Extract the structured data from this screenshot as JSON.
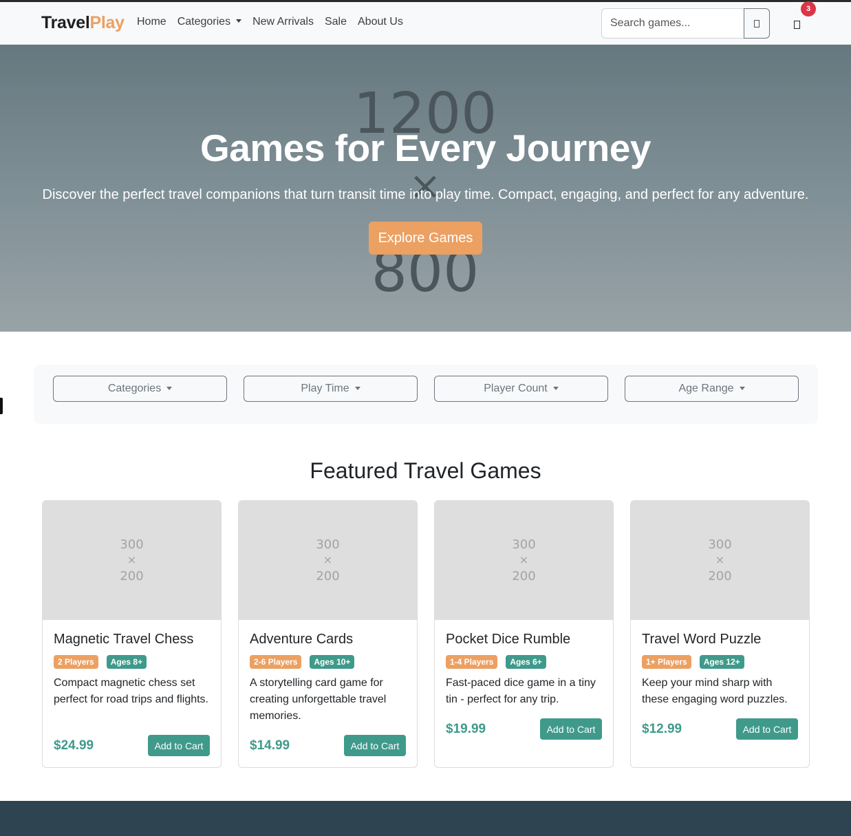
{
  "brand": {
    "part1": "Travel",
    "part2": "Play"
  },
  "nav": {
    "home": "Home",
    "categories": "Categories",
    "new_arrivals": "New Arrivals",
    "sale": "Sale",
    "about": "About Us"
  },
  "search": {
    "placeholder": "Search games..."
  },
  "cart": {
    "count": "3"
  },
  "hero": {
    "placeholder_w": "1200",
    "placeholder_x": "×",
    "placeholder_h": "800",
    "title": "Games for Every Journey",
    "subtitle": "Discover the perfect travel companions that turn transit time into play time. Compact, engaging, and perfect for any adventure.",
    "cta": "Explore Games"
  },
  "filters": {
    "categories": "Categories",
    "play_time": "Play Time",
    "player_count": "Player Count",
    "age_range": "Age Range"
  },
  "featured": {
    "title": "Featured Travel Games",
    "image_placeholder": {
      "w": "300",
      "x": "×",
      "h": "200"
    },
    "add_to_cart": "Add to Cart",
    "products": [
      {
        "name": "Magnetic Travel Chess",
        "players": "2 Players",
        "ages": "Ages 8+",
        "description": "Compact magnetic chess set perfect for road trips and flights.",
        "price": "$24.99"
      },
      {
        "name": "Adventure Cards",
        "players": "2-6 Players",
        "ages": "Ages 10+",
        "description": "A storytelling card game for creating unforgettable travel memories.",
        "price": "$14.99"
      },
      {
        "name": "Pocket Dice Rumble",
        "players": "1-4 Players",
        "ages": "Ages 6+",
        "description": "Fast-paced dice game in a tiny tin - perfect for any trip.",
        "price": "$19.99"
      },
      {
        "name": "Travel Word Puzzle",
        "players": "1+ Players",
        "ages": "Ages 12+",
        "description": "Keep your mind sharp with these engaging word puzzles.",
        "price": "$12.99"
      }
    ]
  },
  "colors": {
    "accent_orange": "#eca062",
    "accent_teal": "#3f9a8b",
    "badge_red": "#dc3545",
    "footer": "#2e4450"
  }
}
